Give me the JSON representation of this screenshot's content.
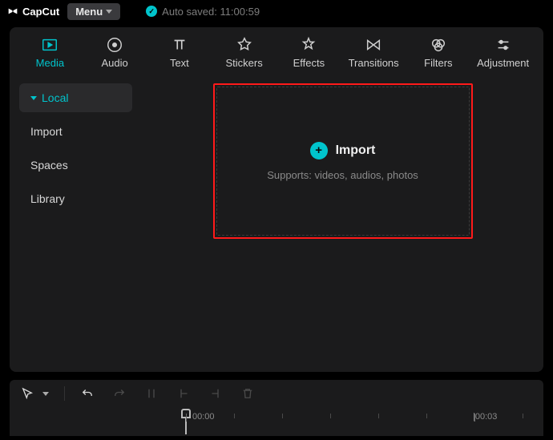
{
  "app": {
    "name": "CapCut"
  },
  "menu": {
    "label": "Menu"
  },
  "autosave": {
    "text": "Auto saved: 11:00:59"
  },
  "tabs": [
    {
      "id": "media",
      "label": "Media",
      "active": true
    },
    {
      "id": "audio",
      "label": "Audio",
      "active": false
    },
    {
      "id": "text",
      "label": "Text",
      "active": false
    },
    {
      "id": "stickers",
      "label": "Stickers",
      "active": false
    },
    {
      "id": "effects",
      "label": "Effects",
      "active": false
    },
    {
      "id": "transitions",
      "label": "Transitions",
      "active": false
    },
    {
      "id": "filters",
      "label": "Filters",
      "active": false
    },
    {
      "id": "adjustment",
      "label": "Adjustment",
      "active": false
    }
  ],
  "sidebar": {
    "items": [
      {
        "label": "Local",
        "active": true,
        "expandable": true
      },
      {
        "label": "Import",
        "active": false,
        "expandable": false
      },
      {
        "label": "Spaces",
        "active": false,
        "expandable": false
      },
      {
        "label": "Library",
        "active": false,
        "expandable": false
      }
    ]
  },
  "import": {
    "label": "Import",
    "subtext": "Supports: videos, audios, photos"
  },
  "timeline": {
    "time0": "00:00",
    "time1": "00:03"
  },
  "colors": {
    "accent": "#00c4cc",
    "highlight": "#ff1a1a",
    "panel": "#1b1b1c"
  }
}
